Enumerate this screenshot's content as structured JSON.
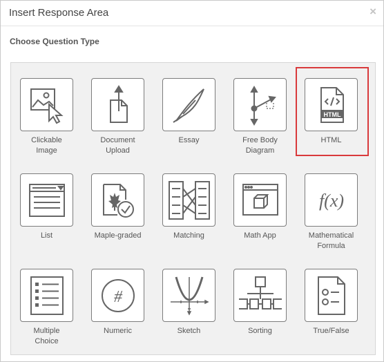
{
  "dialog": {
    "title": "Insert Response Area",
    "close_glyph": "×",
    "subtitle": "Choose Question Type"
  },
  "accent_color": "#d9393b",
  "question_types": [
    {
      "label": "Clickable\nImage",
      "icon": "clickable-image-icon"
    },
    {
      "label": "Document\nUpload",
      "icon": "document-upload-icon"
    },
    {
      "label": "Essay",
      "icon": "feather-pen-icon"
    },
    {
      "label": "Free Body\nDiagram",
      "icon": "free-body-diagram-icon"
    },
    {
      "label": "HTML",
      "icon": "html-file-icon",
      "selected": true,
      "badge": "HTML"
    },
    {
      "label": "List",
      "icon": "list-dropdown-icon"
    },
    {
      "label": "Maple-graded",
      "icon": "maple-leaf-check-icon"
    },
    {
      "label": "Matching",
      "icon": "matching-columns-icon"
    },
    {
      "label": "Math App",
      "icon": "math-app-window-icon"
    },
    {
      "label": "Mathematical\nFormula",
      "icon": "function-fx-icon",
      "glyph": "f(x)"
    },
    {
      "label": "Multiple\nChoice",
      "icon": "multiple-choice-list-icon"
    },
    {
      "label": "Numeric",
      "icon": "hash-circle-icon",
      "glyph": "#"
    },
    {
      "label": "Sketch",
      "icon": "parabola-sketch-icon"
    },
    {
      "label": "Sorting",
      "icon": "sorting-flow-icon"
    },
    {
      "label": "True/False",
      "icon": "true-false-doc-icon"
    }
  ]
}
